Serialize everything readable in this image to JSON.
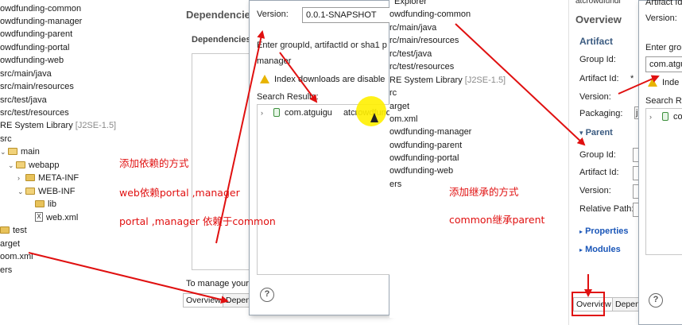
{
  "left_tree": {
    "items": [
      {
        "text": "owdfunding-common"
      },
      {
        "text": "owdfunding-manager"
      },
      {
        "text": "owdfunding-parent"
      },
      {
        "text": "owdfunding-portal"
      },
      {
        "text": "owdfunding-web"
      },
      {
        "text": "src/main/java"
      },
      {
        "text": "src/main/resources"
      },
      {
        "text": "src/test/java"
      },
      {
        "text": "src/test/resources"
      },
      {
        "text": "RE System Library",
        "suffix": "[J2SE-1.5]"
      },
      {
        "text": "src"
      },
      {
        "text": "main"
      },
      {
        "text": "webapp"
      },
      {
        "text": "META-INF"
      },
      {
        "text": "WEB-INF"
      },
      {
        "text": "lib"
      },
      {
        "text": "web.xml"
      },
      {
        "text": "test"
      },
      {
        "text": "arget"
      },
      {
        "text": "oom.xml"
      },
      {
        "text": "ers"
      }
    ]
  },
  "left_editor": {
    "title": "Dependencies",
    "section": "Dependencies",
    "footer": "To manage your",
    "tab_overview": "Overview",
    "tab_dependencies": "Depen"
  },
  "dialog1": {
    "version_label": "Version:",
    "version_value": "0.0.1-SNAPSHOT",
    "enter_label": "Enter groupId, artifactId or sha1 p",
    "search_value": "manager",
    "index_warning": "Index downloads are disable",
    "results_label": "Search Results:",
    "result_group": "com.atguigu",
    "result_artifact": "atcrowdfund",
    "help": "?"
  },
  "annotations_left": [
    "添加依赖的方式",
    "web依赖portal ,manager",
    "portal ,manager 依赖于common"
  ],
  "middle_tree": {
    "header": "Explorer",
    "items": [
      {
        "text": "owdfunding-common"
      },
      {
        "text": "rc/main/java"
      },
      {
        "text": "rc/main/resources"
      },
      {
        "text": "rc/test/java"
      },
      {
        "text": "rc/test/resources"
      },
      {
        "text": "RE System Library",
        "suffix": "[J2SE-1.5]"
      },
      {
        "text": "rc"
      },
      {
        "text": "arget"
      },
      {
        "text": "om.xml"
      },
      {
        "text": "owdfunding-manager"
      },
      {
        "text": "owdfunding-parent"
      },
      {
        "text": "owdfunding-portal"
      },
      {
        "text": "owdfunding-web"
      },
      {
        "text": "ers"
      }
    ]
  },
  "annotations_middle": [
    "添加继承的方式",
    "common继承parent"
  ],
  "overview": {
    "tab_label": "atcrowdfundi",
    "title": "Overview",
    "artifact_section": "Artifact",
    "group_label": "Group Id:",
    "artifact_label": "Artifact Id:",
    "version_label": "Version:",
    "packaging_label": "Packaging:",
    "packaging_value": "ja",
    "parent_section": "Parent",
    "parent_group_label": "Group Id:",
    "parent_artifact_label": "Artifact Id:",
    "parent_version_label": "Version:",
    "relative_path_label": "Relative Path:",
    "properties_link": "Properties",
    "modules_link": "Modules",
    "tab_overview": "Overview",
    "tab_dependencies": "Depen",
    "required_mark": "*"
  },
  "dialog2": {
    "artifact_label": "Artifact Id:",
    "version_label": "Version:",
    "enter_label": "Enter group",
    "search_value": "com.atgui",
    "index_text": "Inde",
    "results_label": "Search Re",
    "result_group": "co",
    "help": "?"
  },
  "colors": {
    "annotation": "#e01010",
    "highlight": "#ffef00",
    "link": "#1a56b8"
  }
}
